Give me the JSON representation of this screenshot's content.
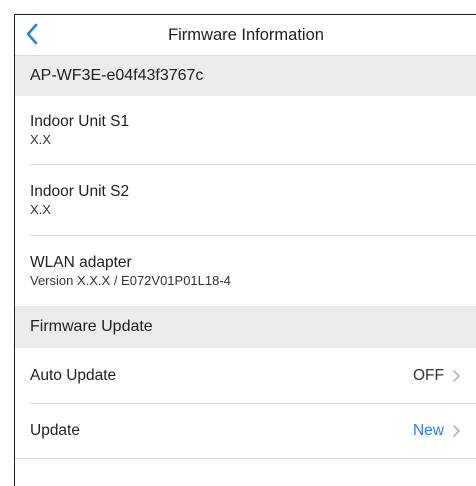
{
  "header": {
    "title": "Firmware Information",
    "back_icon": "chevron-left-icon",
    "accent_color": "#2b7de9"
  },
  "device": {
    "name": "AP-WF3E-e04f43f3767c"
  },
  "units": [
    {
      "name": "Indoor Unit S1",
      "value": "X.X"
    },
    {
      "name": "Indoor Unit S2",
      "value": "X.X"
    },
    {
      "name": "WLAN adapter",
      "value": "Version X.X.X / E072V01P01L18-4"
    }
  ],
  "firmware_update": {
    "section_title": "Firmware Update",
    "auto_update": {
      "label": "Auto Update",
      "value": "OFF",
      "icon": "chevron-right-icon"
    },
    "update": {
      "label": "Update",
      "value": "New",
      "icon": "chevron-right-icon",
      "value_color": "#2b7de9"
    }
  }
}
